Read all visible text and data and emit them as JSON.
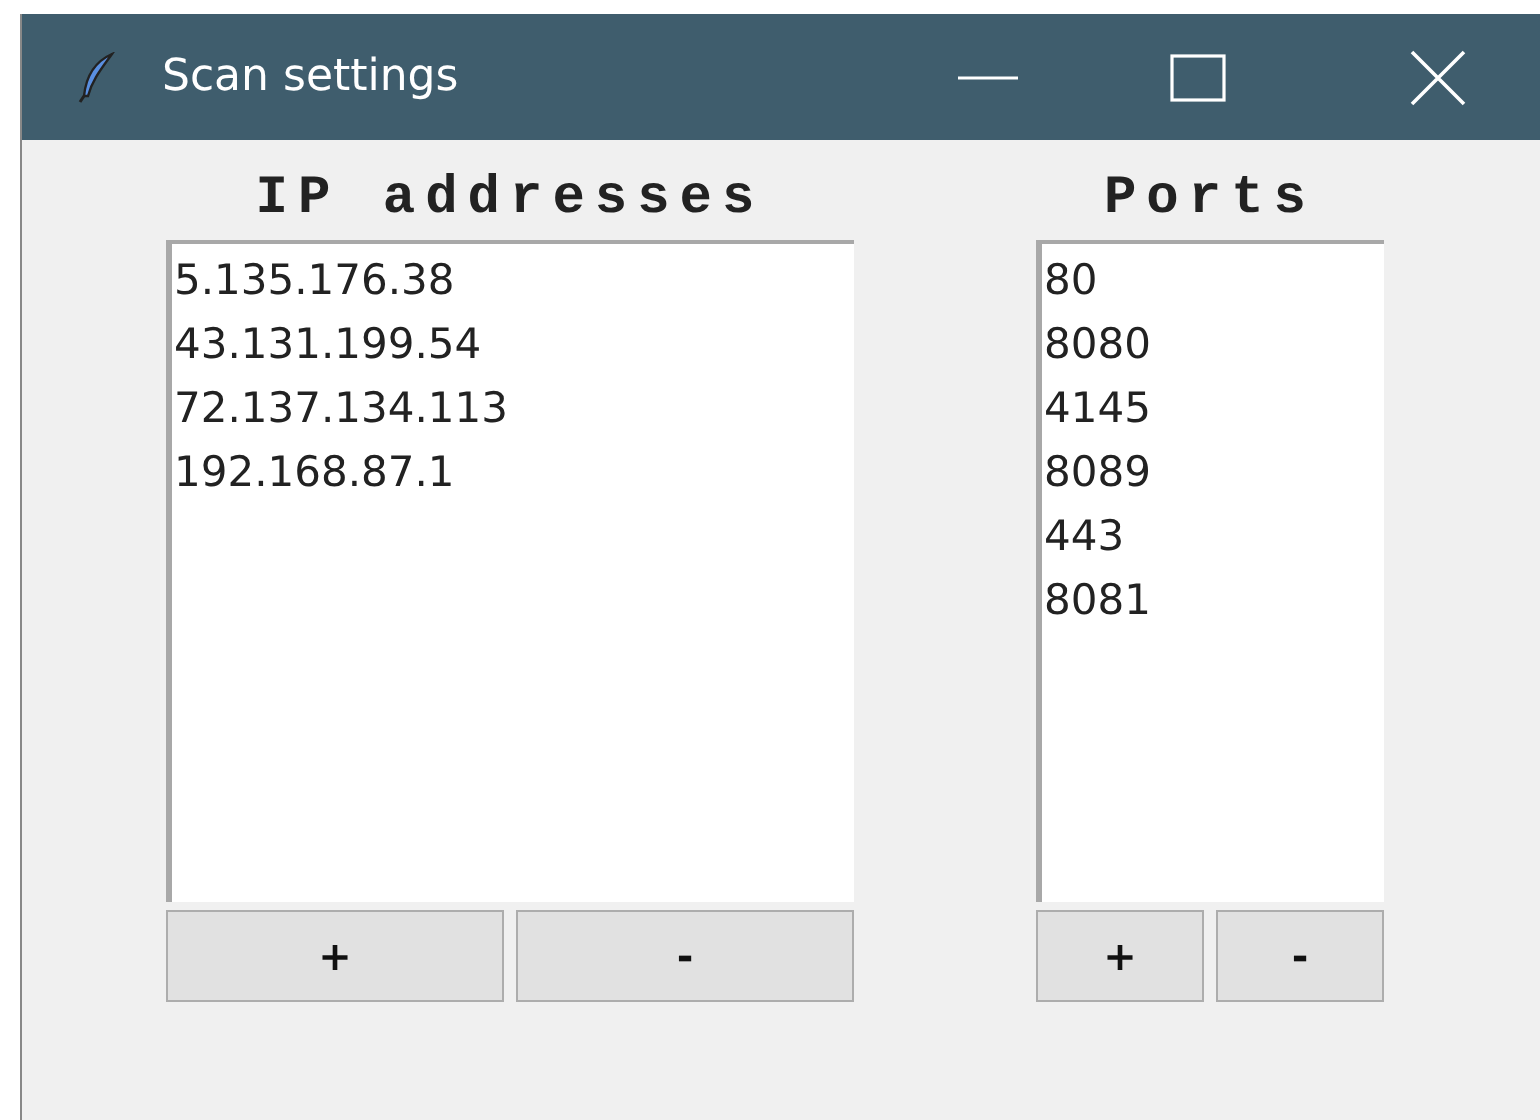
{
  "window": {
    "title": "Scan settings"
  },
  "panels": [
    {
      "label": "IP addresses",
      "items": [
        "5.135.176.38",
        "43.131.199.54",
        "72.137.134.113",
        "192.168.87.1"
      ],
      "buttons": [
        "+",
        "-"
      ]
    },
    {
      "label": "Ports",
      "items": [
        "80",
        "8080",
        "4145",
        "8089",
        "443",
        "8081"
      ],
      "buttons": [
        "+",
        "-"
      ]
    }
  ]
}
